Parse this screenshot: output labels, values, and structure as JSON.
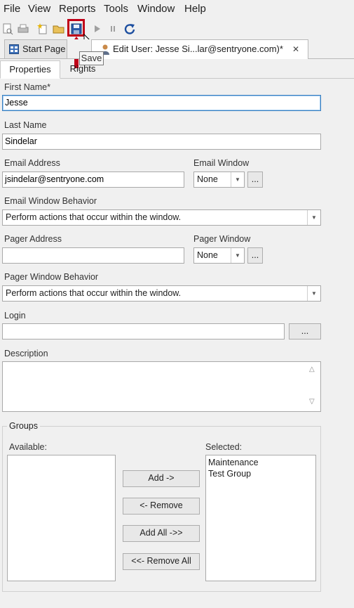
{
  "menu": [
    "File",
    "View",
    "Reports",
    "Tools",
    "Window",
    "Help"
  ],
  "toolbar": {
    "icons": [
      "new-report-icon",
      "print-icon",
      "new-icon",
      "open-folder-icon",
      "save-icon",
      "play-icon",
      "pause-icon",
      "refresh-icon"
    ],
    "tooltip": "Save"
  },
  "tabs": {
    "start": "Start Page",
    "edit": "Edit User: Jesse Si...lar@sentryone.com)*",
    "close": "✕"
  },
  "subtabs": [
    "Properties",
    "Rights"
  ],
  "form": {
    "first_name_label": "First Name*",
    "first_name": "Jesse",
    "last_name_label": "Last Name",
    "last_name": "Sindelar",
    "email_label": "Email Address",
    "email": "jsindelar@sentryone.com",
    "email_window_label": "Email Window",
    "email_window": "None",
    "email_behavior_label": "Email Window Behavior",
    "email_behavior": "Perform actions that occur within the window.",
    "pager_label": "Pager Address",
    "pager": "",
    "pager_window_label": "Pager Window",
    "pager_window": "None",
    "pager_behavior_label": "Pager Window Behavior",
    "pager_behavior": "Perform actions that occur within the window.",
    "login_label": "Login",
    "login": "",
    "ellipsis": "...",
    "description_label": "Description",
    "description": ""
  },
  "groups": {
    "title": "Groups",
    "available_label": "Available:",
    "selected_label": "Selected:",
    "available": [],
    "selected": [
      "Maintenance",
      "Test Group"
    ],
    "buttons": {
      "add": "Add ->",
      "remove": "<- Remove",
      "add_all": "Add All ->>",
      "remove_all": "<<- Remove All"
    }
  },
  "colors": {
    "highlight": "#c00018",
    "focus": "#3a7fbf"
  }
}
